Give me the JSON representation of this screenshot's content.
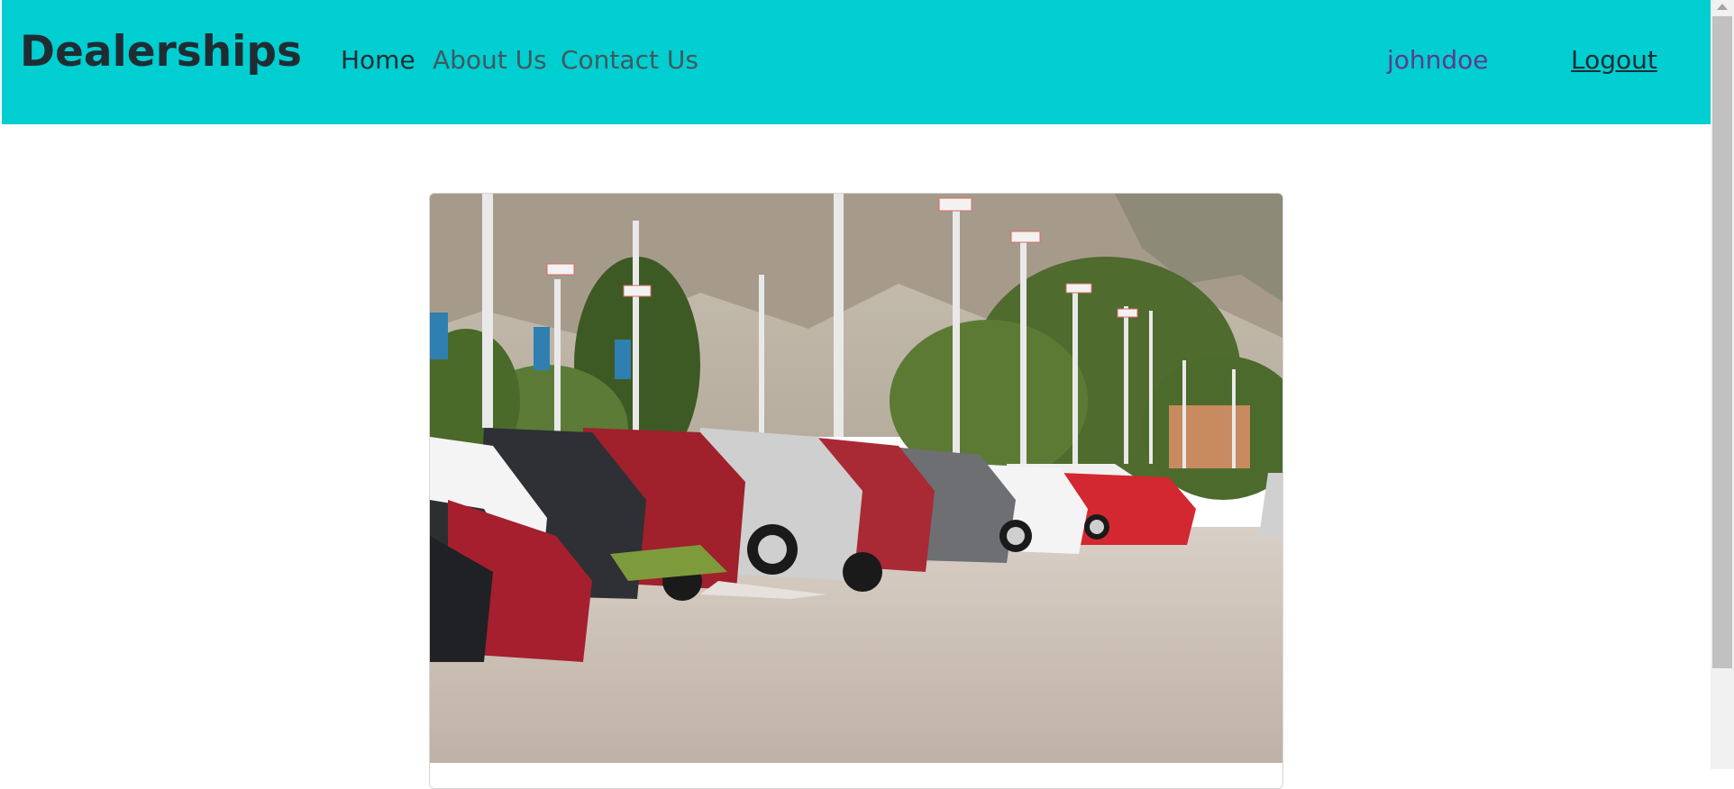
{
  "navbar": {
    "brand": "Dealerships",
    "links": [
      {
        "label": "Home"
      },
      {
        "label": "About Us"
      },
      {
        "label": "Contact Us"
      }
    ],
    "username": "johndoe",
    "logout_label": "Logout",
    "background_color": "#00ced1"
  },
  "main": {
    "hero_image": {
      "description_icon": "car-dealership-lot-image"
    },
    "caption": ""
  }
}
